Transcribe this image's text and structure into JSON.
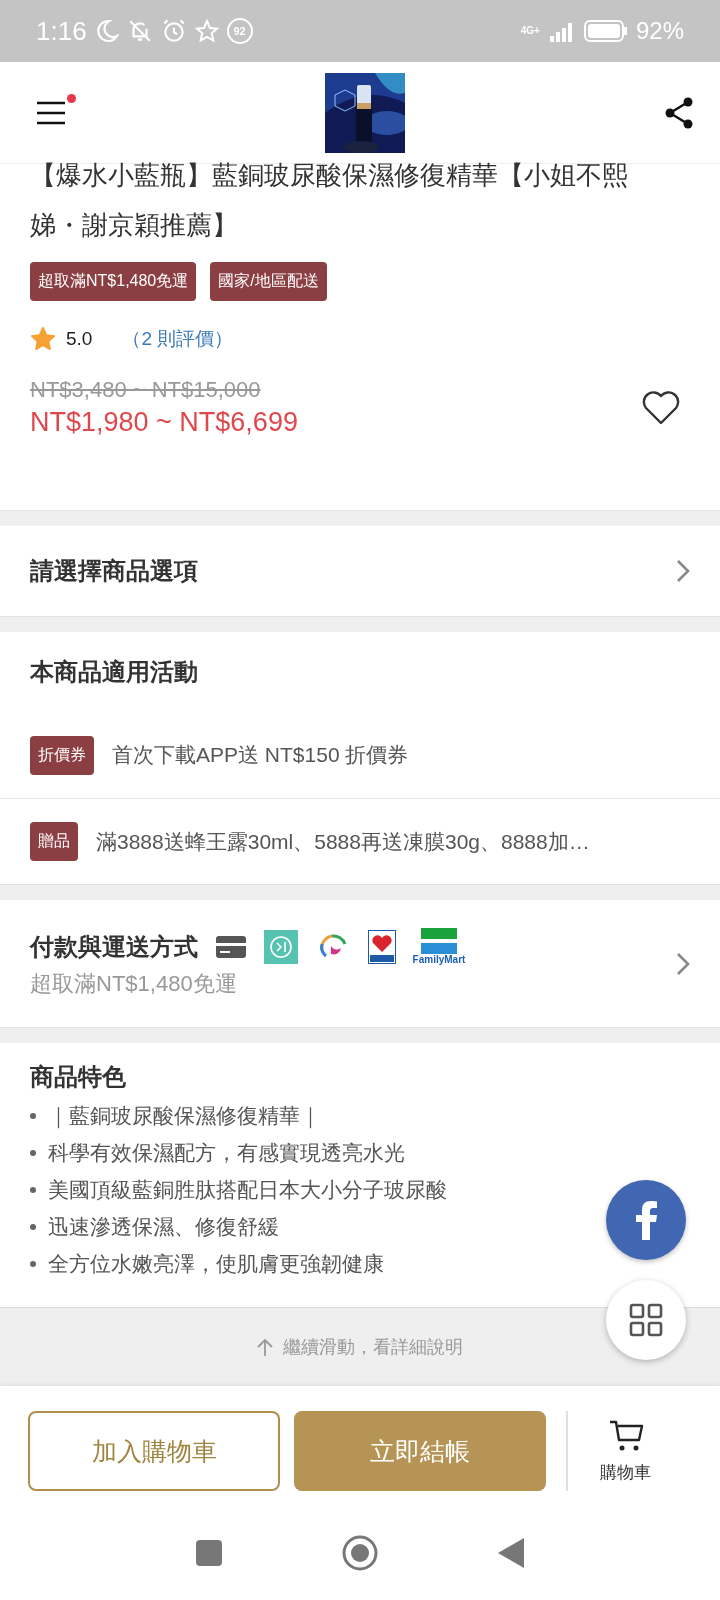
{
  "status_bar": {
    "time": "1:16",
    "notification_count": "92",
    "network": "4G+",
    "battery": "92%"
  },
  "header": {
    "menu_badge": true
  },
  "product": {
    "title": "【爆水小藍瓶】藍銅玻尿酸保濕修復精華【小姐不熙娣・謝京穎推薦】",
    "tags": [
      "超取滿NT$1,480免運",
      "國家/地區配送"
    ],
    "rating": "5.0",
    "reviews": "（2 則評價）",
    "original_price": "NT$3,480 ~ NT$15,000",
    "price": "NT$1,980 ~ NT$6,699",
    "favorited": false
  },
  "option_selector": {
    "label": "請選擇商品選項"
  },
  "promotions": {
    "title": "本商品適用活動",
    "items": [
      {
        "tag": "折價券",
        "text": "首次下載APP送 NT$150 折價券"
      },
      {
        "tag": "贈品",
        "text": "滿3888送蜂王露30ml、5888再送凍膜30g、8888加…"
      }
    ]
  },
  "payment": {
    "title": "付款與運送方式",
    "subtitle": "超取滿NT$1,480免運",
    "logo_caption": "FamilyMart"
  },
  "features": {
    "title": "商品特色",
    "items": [
      "｜藍銅玻尿酸保濕修復精華｜",
      "科學有效保濕配方，有感實現透亮水光",
      "美國頂級藍銅胜肽搭配日本大小分子玻尿酸",
      "迅速滲透保濕、修復舒緩",
      "全方位水嫩亮澤，使肌膚更強韌健康"
    ]
  },
  "scroll_hint": "繼續滑動，看詳細說明",
  "actions": {
    "add_to_cart": "加入購物車",
    "checkout": "立即結帳",
    "cart": "購物車"
  }
}
